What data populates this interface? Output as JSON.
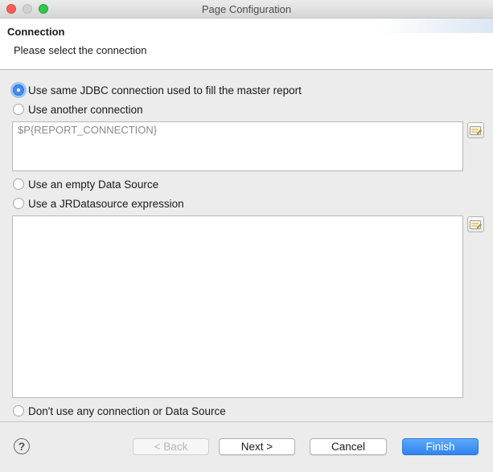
{
  "window": {
    "title": "Page Configuration"
  },
  "header": {
    "title": "Connection",
    "subtitle": "Please select the connection"
  },
  "options": {
    "same_jdbc": {
      "label": "Use same JDBC connection used to fill the master report",
      "checked": true
    },
    "another_connection": {
      "label": "Use another connection",
      "checked": false
    },
    "connection_expression": {
      "value": "$P{REPORT_CONNECTION}"
    },
    "empty_datasource": {
      "label": "Use an empty Data Source",
      "checked": false
    },
    "jrdatasource_expression": {
      "label": "Use a JRDatasource expression",
      "checked": false
    },
    "datasource_expression": {
      "value": ""
    },
    "no_connection": {
      "label": "Don't use any connection or Data Source",
      "checked": false
    }
  },
  "icons": {
    "help": "help-icon",
    "expression_editor": "expression-editor-icon"
  },
  "footer": {
    "help_glyph": "?",
    "back_label": "< Back",
    "next_label": "Next >",
    "cancel_label": "Cancel",
    "finish_label": "Finish"
  },
  "colors": {
    "accent": "#3f8cf4",
    "finish_button": "#2f84f2",
    "close_traffic": "#fc5f57",
    "zoom_traffic": "#34c84a"
  }
}
